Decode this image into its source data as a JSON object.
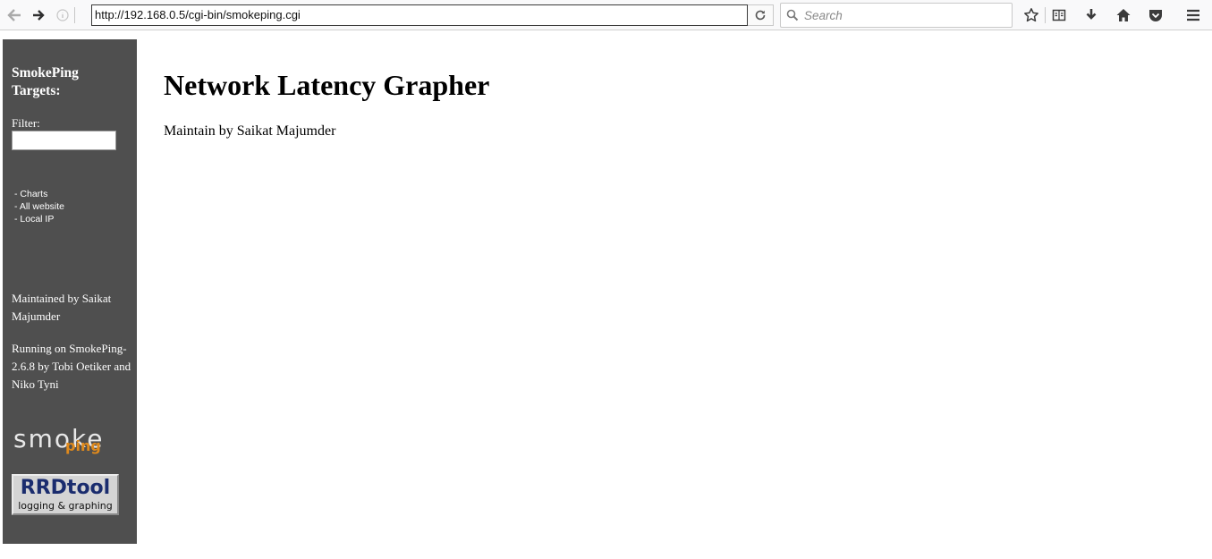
{
  "browser": {
    "url": "http://192.168.0.5/cgi-bin/smokeping.cgi",
    "search_placeholder": "Search"
  },
  "icons": {
    "back": "back-arrow-icon",
    "forward": "forward-arrow-icon",
    "info": "info-icon",
    "reload": "reload-icon",
    "search": "search-icon",
    "bookmark": "star-icon",
    "reader": "reader-view-icon",
    "download": "download-icon",
    "home": "home-icon",
    "pocket": "pocket-icon",
    "menu": "hamburger-menu-icon"
  },
  "sidebar": {
    "title": "SmokePing Targets:",
    "filter_label": "Filter:",
    "filter_value": "",
    "menu_items": [
      "- Charts",
      "- All website",
      "- Local IP"
    ],
    "maintained_by": "Maintained by Saikat Majumder",
    "running_on": "Running on SmokePing-2.6.8 by Tobi Oetiker and Niko Tyni",
    "logo_smoke_word": "smoke",
    "logo_smoke_ping": "ping",
    "logo_rrd_title": "RRDtool",
    "logo_rrd_sub": "logging & graphing",
    "colors": {
      "background": "#4f4f4f",
      "text": "#ffffff",
      "ping_orange": "#e08a1c"
    }
  },
  "main": {
    "title": "Network Latency Grapher",
    "subtitle": "Maintain by Saikat Majumder"
  }
}
